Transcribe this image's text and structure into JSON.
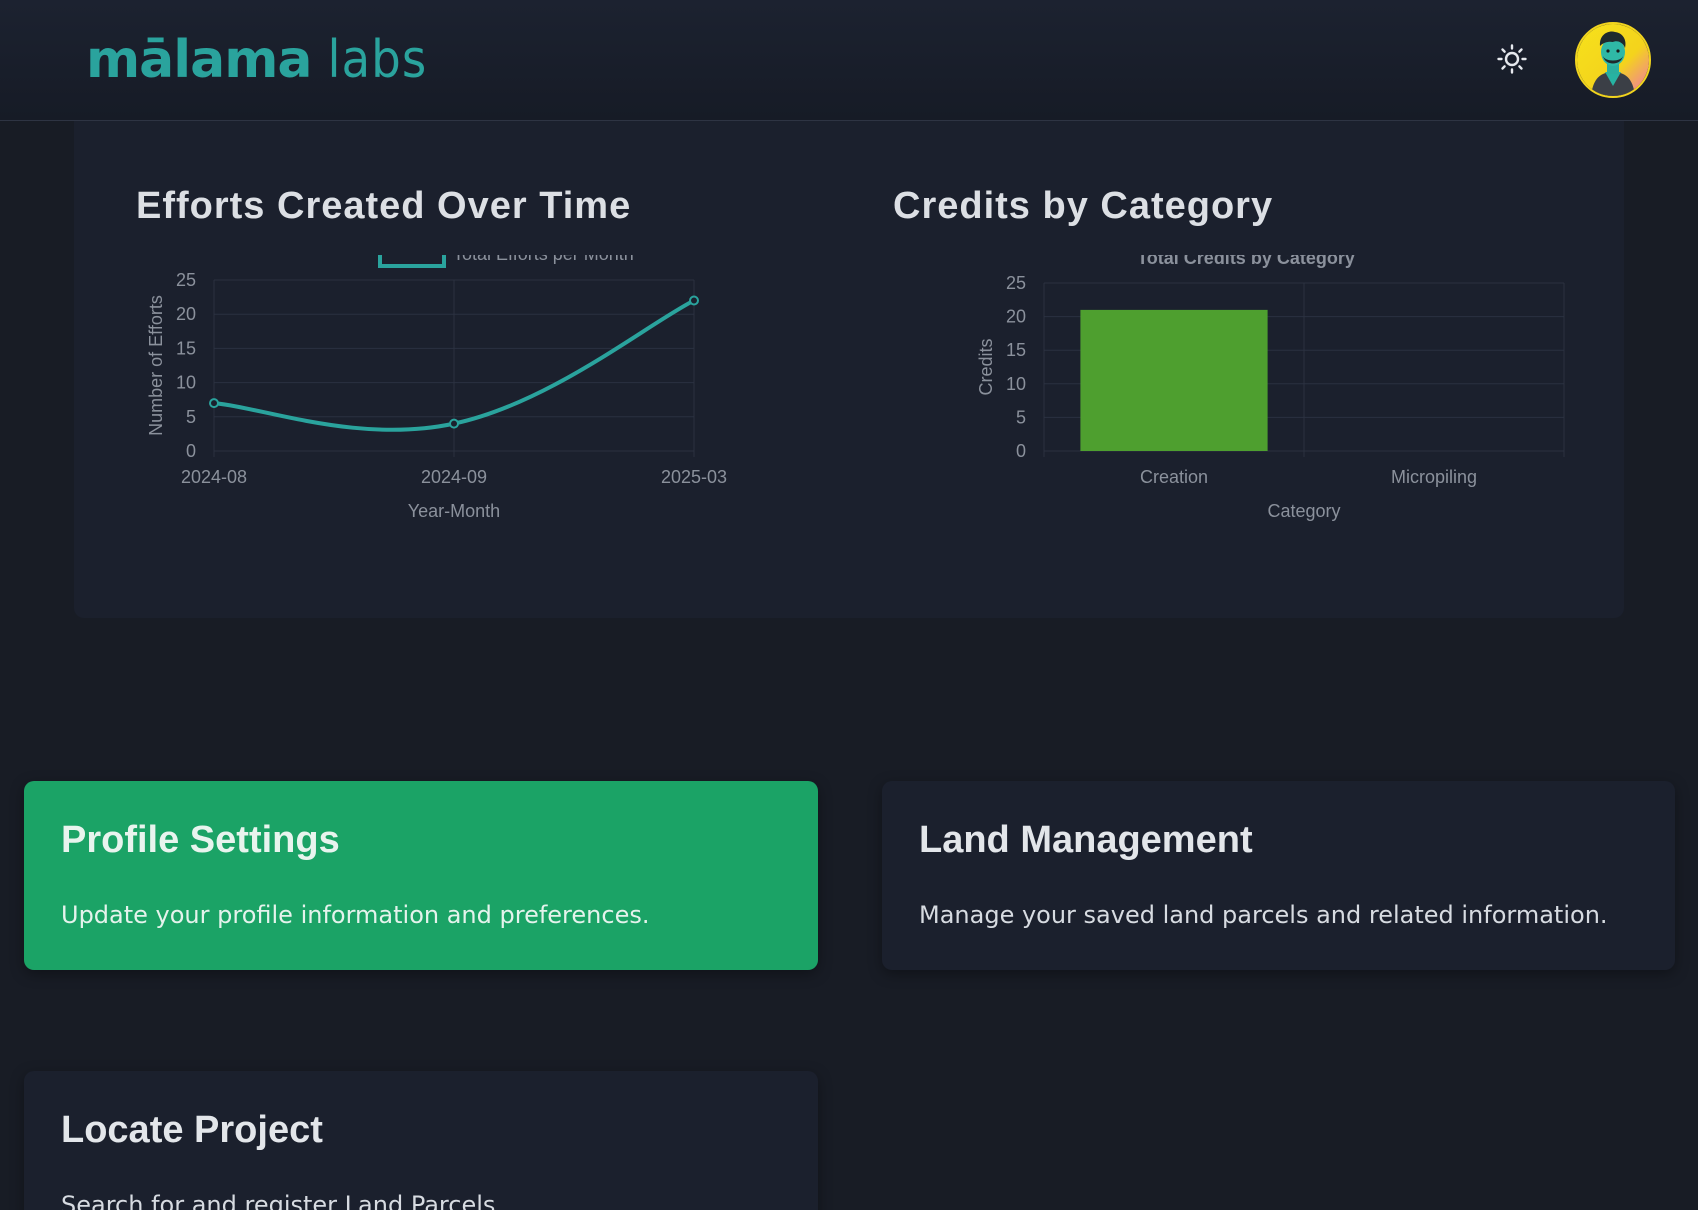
{
  "header": {
    "logo_main": "mālama",
    "logo_sub": "labs",
    "theme_toggle_icon": "sun-icon",
    "avatar_icon": "user-avatar"
  },
  "charts": {
    "efforts_title": "Efforts Created Over Time",
    "credits_title": "Credits by Category"
  },
  "chart_data": [
    {
      "type": "line",
      "legend": "Total Efforts per Month",
      "x": [
        "2024-08",
        "2024-09",
        "2025-03"
      ],
      "values": [
        7,
        4,
        22
      ],
      "xlabel": "Year-Month",
      "ylabel": "Number of Efforts",
      "ylim": [
        0,
        25
      ],
      "yticks": [
        0,
        5,
        10,
        15,
        20,
        25
      ],
      "color": "#2aa39d",
      "grid": true,
      "legend_position": "top"
    },
    {
      "type": "bar",
      "title": "Total Credits by Category",
      "categories": [
        "Creation",
        "Micropiling"
      ],
      "values": [
        21,
        0
      ],
      "xlabel": "Category",
      "ylabel": "Credits",
      "ylim": [
        0,
        25
      ],
      "yticks": [
        0,
        5,
        10,
        15,
        20,
        25
      ],
      "color": "#4e9f2f",
      "grid": true
    }
  ],
  "cards": [
    {
      "title": "Profile Settings",
      "desc": "Update your profile information and preferences.",
      "active": true
    },
    {
      "title": "Land Management",
      "desc": "Manage your saved land parcels and related information.",
      "active": false
    },
    {
      "title": "Locate Project",
      "desc": "Search for and register Land Parcels",
      "active": false
    }
  ],
  "colors": {
    "accent": "#2aa39d",
    "active_card": "#1ba366",
    "background": "#181c25",
    "panel": "#1b202d"
  }
}
